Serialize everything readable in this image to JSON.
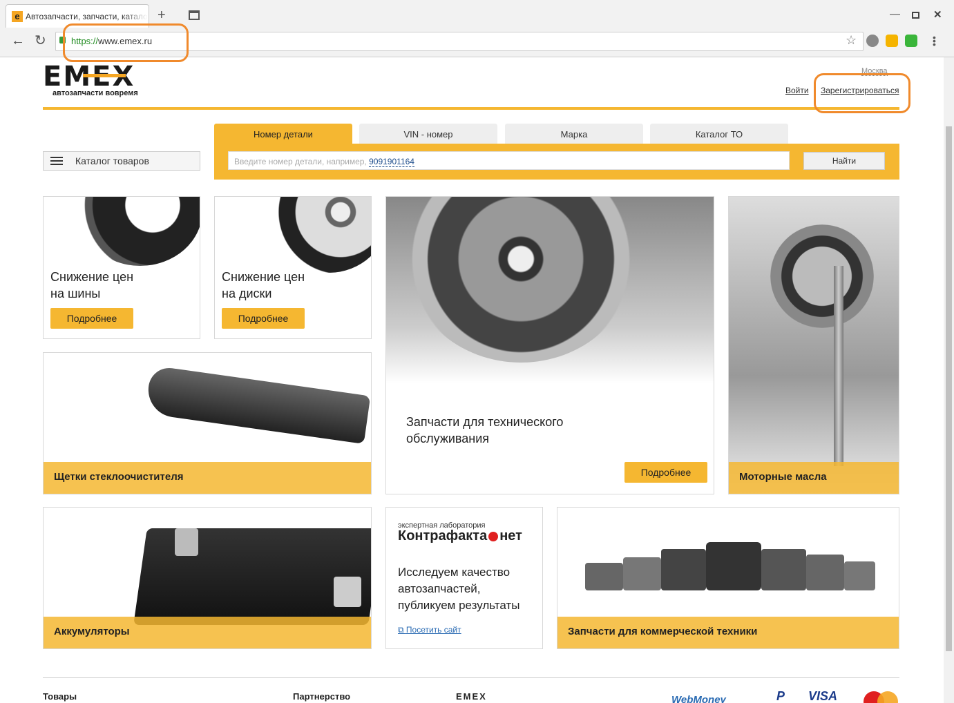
{
  "browser": {
    "tab_title": "Автозапчасти, запчасти, катало",
    "favicon_letter": "e",
    "url_scheme": "https://",
    "url_host": "www.emex.ru"
  },
  "header": {
    "logo_text": "EMEX",
    "tagline": "автозапчасти вовремя",
    "city": "Москва",
    "login": "Войти",
    "register": "Зарегистрироваться"
  },
  "search": {
    "tabs": [
      "Номер детали",
      "VIN - номер",
      "Марка",
      "Каталог ТО"
    ],
    "active_tab": 0,
    "placeholder": "Введите номер детали, например,",
    "example": "9091901164",
    "button": "Найти"
  },
  "catalog_button": "Каталог товаров",
  "cards": {
    "tires": {
      "title1": "Снижение цен",
      "title2": "на шины",
      "button": "Подробнее"
    },
    "rims": {
      "title1": "Снижение цен",
      "title2": "на диски",
      "button": "Подробнее"
    },
    "maintenance": {
      "title1": "Запчасти для технического",
      "title2": "обслуживания",
      "button": "Подробнее"
    },
    "oil": {
      "band": "Моторные масла"
    },
    "wipers": {
      "band": "Щетки стеклоочистителя"
    },
    "batteries": {
      "band": "Аккумуляторы"
    },
    "counterfeit": {
      "small": "экспертная лаборатория",
      "brand1": "Контрафакта",
      "brand2": "нет",
      "text1": "Исследуем качество",
      "text2": "автозапчастей,",
      "text3": "публикуем результаты",
      "link": "Посетить сайт"
    },
    "commercial": {
      "band": "Запчасти для коммерческой техники"
    }
  },
  "footer": {
    "col1": "Товары",
    "col2": "Партнерство",
    "col3": "EMEX",
    "pay1": "WebMoney",
    "pay2": "P",
    "pay3": "VISA"
  },
  "colors": {
    "accent": "#f5b731",
    "annotation": "#f08a2c"
  }
}
